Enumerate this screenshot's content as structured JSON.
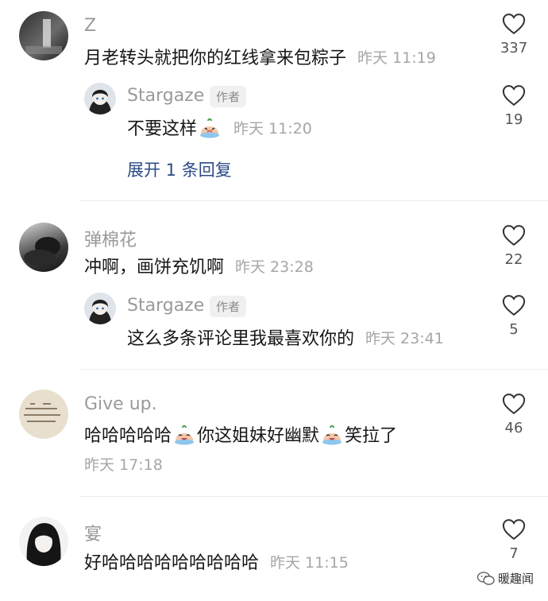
{
  "comments": [
    {
      "username": "Z",
      "text": "月老转头就把你的红线拿来包粽子",
      "time": "昨天 11:19",
      "likes": "337",
      "reply": {
        "username": "Stargaze",
        "tag": "作者",
        "text": "不要这样",
        "emoji": "crying-face",
        "time": "昨天 11:20",
        "likes": "19"
      },
      "expand_label": "展开 1 条回复"
    },
    {
      "username": "弹棉花",
      "text": "冲啊，画饼充饥啊",
      "time": "昨天 23:28",
      "likes": "22",
      "reply": {
        "username": "Stargaze",
        "tag": "作者",
        "text": "这么多条评论里我最喜欢你的",
        "time": "昨天 23:41",
        "likes": "5"
      }
    },
    {
      "username": "Give up.",
      "text_part1": "哈哈哈哈哈",
      "text_part2": "你这姐妹好幽默",
      "text_part3": "笑拉了",
      "emoji": "laugh-cry-face",
      "time": "昨天 17:18",
      "likes": "46"
    },
    {
      "username": "宴",
      "text": "好哈哈哈哈哈哈哈哈哈",
      "time": "昨天 11:15",
      "likes": "7"
    }
  ],
  "watermark": "暖趣闻",
  "colors": {
    "username": "#9a9a9a",
    "timestamp": "#a6a6a6",
    "link": "#2b4a86",
    "divider": "#ececec"
  }
}
